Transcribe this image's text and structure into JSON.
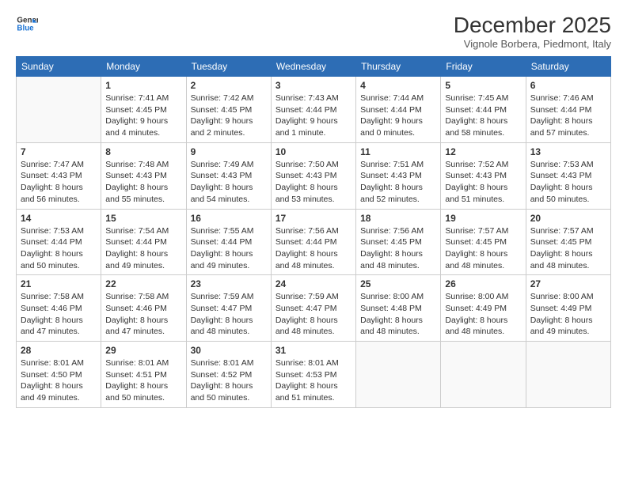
{
  "header": {
    "logo_line1": "General",
    "logo_line2": "Blue",
    "month_title": "December 2025",
    "subtitle": "Vignole Borbera, Piedmont, Italy"
  },
  "weekdays": [
    "Sunday",
    "Monday",
    "Tuesday",
    "Wednesday",
    "Thursday",
    "Friday",
    "Saturday"
  ],
  "weeks": [
    [
      {
        "day": "",
        "info": ""
      },
      {
        "day": "1",
        "info": "Sunrise: 7:41 AM\nSunset: 4:45 PM\nDaylight: 9 hours\nand 4 minutes."
      },
      {
        "day": "2",
        "info": "Sunrise: 7:42 AM\nSunset: 4:45 PM\nDaylight: 9 hours\nand 2 minutes."
      },
      {
        "day": "3",
        "info": "Sunrise: 7:43 AM\nSunset: 4:44 PM\nDaylight: 9 hours\nand 1 minute."
      },
      {
        "day": "4",
        "info": "Sunrise: 7:44 AM\nSunset: 4:44 PM\nDaylight: 9 hours\nand 0 minutes."
      },
      {
        "day": "5",
        "info": "Sunrise: 7:45 AM\nSunset: 4:44 PM\nDaylight: 8 hours\nand 58 minutes."
      },
      {
        "day": "6",
        "info": "Sunrise: 7:46 AM\nSunset: 4:44 PM\nDaylight: 8 hours\nand 57 minutes."
      }
    ],
    [
      {
        "day": "7",
        "info": "Sunrise: 7:47 AM\nSunset: 4:43 PM\nDaylight: 8 hours\nand 56 minutes."
      },
      {
        "day": "8",
        "info": "Sunrise: 7:48 AM\nSunset: 4:43 PM\nDaylight: 8 hours\nand 55 minutes."
      },
      {
        "day": "9",
        "info": "Sunrise: 7:49 AM\nSunset: 4:43 PM\nDaylight: 8 hours\nand 54 minutes."
      },
      {
        "day": "10",
        "info": "Sunrise: 7:50 AM\nSunset: 4:43 PM\nDaylight: 8 hours\nand 53 minutes."
      },
      {
        "day": "11",
        "info": "Sunrise: 7:51 AM\nSunset: 4:43 PM\nDaylight: 8 hours\nand 52 minutes."
      },
      {
        "day": "12",
        "info": "Sunrise: 7:52 AM\nSunset: 4:43 PM\nDaylight: 8 hours\nand 51 minutes."
      },
      {
        "day": "13",
        "info": "Sunrise: 7:53 AM\nSunset: 4:43 PM\nDaylight: 8 hours\nand 50 minutes."
      }
    ],
    [
      {
        "day": "14",
        "info": "Sunrise: 7:53 AM\nSunset: 4:44 PM\nDaylight: 8 hours\nand 50 minutes."
      },
      {
        "day": "15",
        "info": "Sunrise: 7:54 AM\nSunset: 4:44 PM\nDaylight: 8 hours\nand 49 minutes."
      },
      {
        "day": "16",
        "info": "Sunrise: 7:55 AM\nSunset: 4:44 PM\nDaylight: 8 hours\nand 49 minutes."
      },
      {
        "day": "17",
        "info": "Sunrise: 7:56 AM\nSunset: 4:44 PM\nDaylight: 8 hours\nand 48 minutes."
      },
      {
        "day": "18",
        "info": "Sunrise: 7:56 AM\nSunset: 4:45 PM\nDaylight: 8 hours\nand 48 minutes."
      },
      {
        "day": "19",
        "info": "Sunrise: 7:57 AM\nSunset: 4:45 PM\nDaylight: 8 hours\nand 48 minutes."
      },
      {
        "day": "20",
        "info": "Sunrise: 7:57 AM\nSunset: 4:45 PM\nDaylight: 8 hours\nand 48 minutes."
      }
    ],
    [
      {
        "day": "21",
        "info": "Sunrise: 7:58 AM\nSunset: 4:46 PM\nDaylight: 8 hours\nand 47 minutes."
      },
      {
        "day": "22",
        "info": "Sunrise: 7:58 AM\nSunset: 4:46 PM\nDaylight: 8 hours\nand 47 minutes."
      },
      {
        "day": "23",
        "info": "Sunrise: 7:59 AM\nSunset: 4:47 PM\nDaylight: 8 hours\nand 48 minutes."
      },
      {
        "day": "24",
        "info": "Sunrise: 7:59 AM\nSunset: 4:47 PM\nDaylight: 8 hours\nand 48 minutes."
      },
      {
        "day": "25",
        "info": "Sunrise: 8:00 AM\nSunset: 4:48 PM\nDaylight: 8 hours\nand 48 minutes."
      },
      {
        "day": "26",
        "info": "Sunrise: 8:00 AM\nSunset: 4:49 PM\nDaylight: 8 hours\nand 48 minutes."
      },
      {
        "day": "27",
        "info": "Sunrise: 8:00 AM\nSunset: 4:49 PM\nDaylight: 8 hours\nand 49 minutes."
      }
    ],
    [
      {
        "day": "28",
        "info": "Sunrise: 8:01 AM\nSunset: 4:50 PM\nDaylight: 8 hours\nand 49 minutes."
      },
      {
        "day": "29",
        "info": "Sunrise: 8:01 AM\nSunset: 4:51 PM\nDaylight: 8 hours\nand 50 minutes."
      },
      {
        "day": "30",
        "info": "Sunrise: 8:01 AM\nSunset: 4:52 PM\nDaylight: 8 hours\nand 50 minutes."
      },
      {
        "day": "31",
        "info": "Sunrise: 8:01 AM\nSunset: 4:53 PM\nDaylight: 8 hours\nand 51 minutes."
      },
      {
        "day": "",
        "info": ""
      },
      {
        "day": "",
        "info": ""
      },
      {
        "day": "",
        "info": ""
      }
    ]
  ]
}
